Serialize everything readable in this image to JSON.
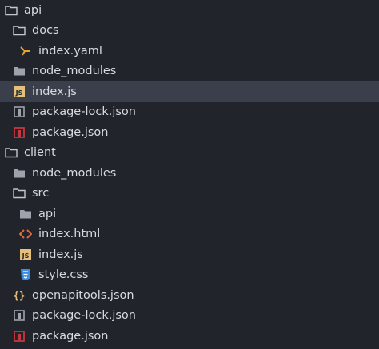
{
  "tree": [
    {
      "label": "api",
      "icon": "folder-open-icon",
      "level": "l0",
      "kind": "folder-open"
    },
    {
      "label": "docs",
      "icon": "folder-open-icon",
      "level": "l1",
      "kind": "folder-open"
    },
    {
      "label": "index.yaml",
      "icon": "yaml-icon",
      "level": "l2",
      "kind": "yaml"
    },
    {
      "label": "node_modules",
      "icon": "folder-closed-icon",
      "level": "l1",
      "kind": "folder-closed"
    },
    {
      "label": "index.js",
      "icon": "js-icon",
      "level": "l1",
      "kind": "js",
      "selected": true
    },
    {
      "label": "package-lock.json",
      "icon": "npm-lock-icon",
      "level": "l1",
      "kind": "npm-lock"
    },
    {
      "label": "package.json",
      "icon": "npm-icon",
      "level": "l1",
      "kind": "npm"
    },
    {
      "label": "client",
      "icon": "folder-open-icon",
      "level": "l0",
      "kind": "folder-open"
    },
    {
      "label": "node_modules",
      "icon": "folder-closed-icon",
      "level": "l1",
      "kind": "folder-closed"
    },
    {
      "label": "src",
      "icon": "folder-open-icon",
      "level": "l1",
      "kind": "folder-open"
    },
    {
      "label": "api",
      "icon": "folder-closed-icon",
      "level": "l2",
      "kind": "folder-closed"
    },
    {
      "label": "index.html",
      "icon": "html-icon",
      "level": "l2",
      "kind": "html"
    },
    {
      "label": "index.js",
      "icon": "js-icon",
      "level": "l2",
      "kind": "js"
    },
    {
      "label": "style.css",
      "icon": "css-icon",
      "level": "l2",
      "kind": "css"
    },
    {
      "label": "openapitools.json",
      "icon": "json-icon",
      "level": "l1",
      "kind": "json"
    },
    {
      "label": "package-lock.json",
      "icon": "npm-lock-icon",
      "level": "l1",
      "kind": "npm-lock"
    },
    {
      "label": "package.json",
      "icon": "npm-icon",
      "level": "l1",
      "kind": "npm"
    }
  ],
  "colors": {
    "background": "#21252b",
    "selected_row": "#3a3f4b",
    "text": "#d7dae0",
    "folder": "#c5c8ce",
    "js": "#e5c07b",
    "html": "#e06c3b",
    "css": "#3b8ee0",
    "npm": "#c7363d",
    "yaml": "#e5a33b",
    "json": "#e5c07b"
  }
}
